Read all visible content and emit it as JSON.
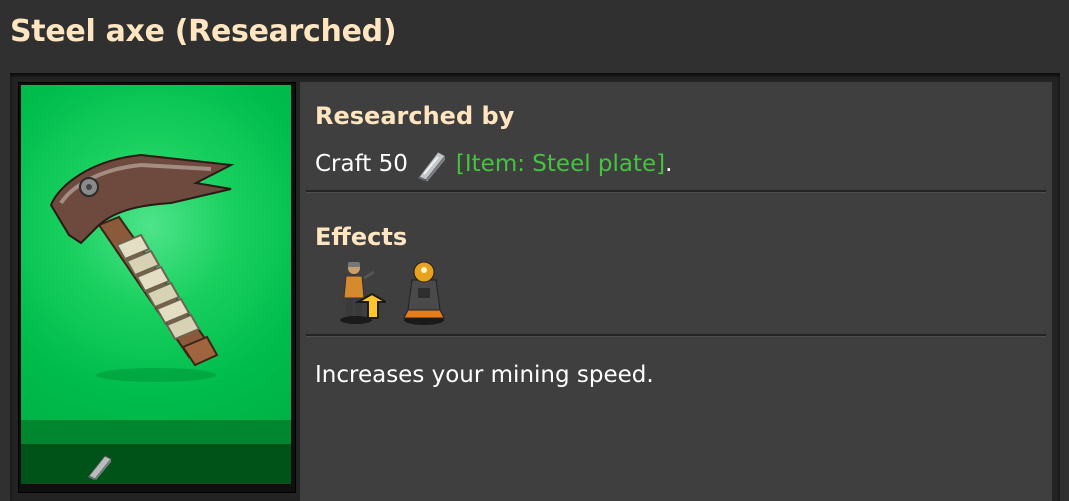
{
  "window": {
    "title": "Steel axe (Researched)"
  },
  "tile": {
    "art_icon": "steel-axe-icon",
    "cost_icon": "steel-plate-icon",
    "colors": {
      "researched_green": "#00bd4d",
      "band": "#00862f",
      "cost_bar": "#005318"
    }
  },
  "researched_by": {
    "heading": "Researched by",
    "prefix": "Craft 50",
    "item_icon": "steel-plate-icon",
    "item_link": "[Item: Steel plate]",
    "suffix": "."
  },
  "effects": {
    "heading": "Effects",
    "icons": [
      "character-mining-speed-icon",
      "mining-drill-character-icon"
    ]
  },
  "description": "Increases your mining speed."
}
